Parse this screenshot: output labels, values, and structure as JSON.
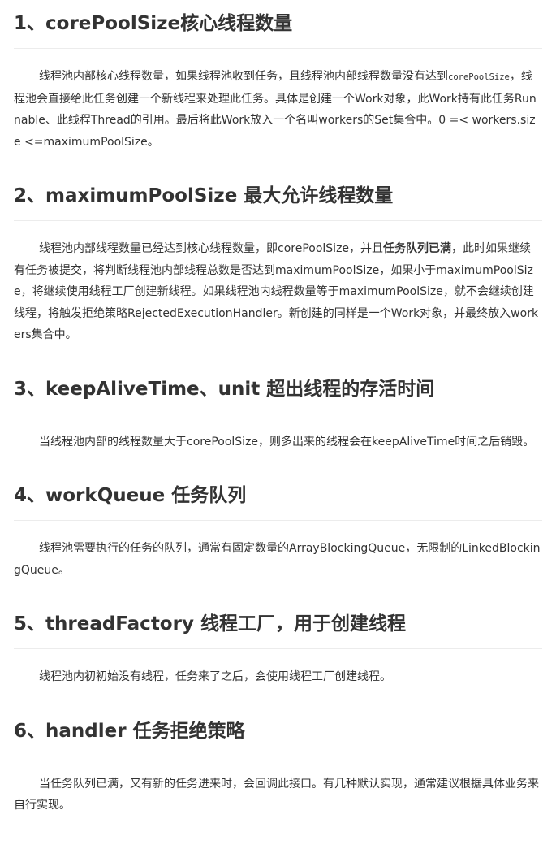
{
  "sections": [
    {
      "title": "1、corePoolSize核心线程数量",
      "para": {
        "p1": "线程池内部核心线程数量，如果线程池收到任务，且线程池内部线程数量没有达到",
        "code": "corePoolSize",
        "p2": "，线程池会直接给此任务创建一个新线程来处理此任务。具体是创建一个Work对象，此Work持有此任务Runnable、此线程Thread的引用。最后将此Work放入一个名叫workers的Set集合中。0 =< workers.size <=maximumPoolSize。"
      }
    },
    {
      "title": "2、maximumPoolSize 最大允许线程数量",
      "para": {
        "p1": "线程池内部线程数量已经达到核心线程数量，即corePoolSize，并且",
        "bold": "任务队列已满",
        "p2": "，此时如果继续有任务被提交，将判断线程池内部线程总数是否达到maximumPoolSize，如果小于maximumPoolSize，将继续使用线程工厂创建新线程。如果线程池内线程数量等于maximumPoolSize，就不会继续创建线程，将触发拒绝策略RejectedExecutionHandler。新创建的同样是一个Work对象，并最终放入workers集合中。"
      }
    },
    {
      "title": "3、keepAliveTime、unit 超出线程的存活时间",
      "para": {
        "text": "当线程池内部的线程数量大于corePoolSize，则多出来的线程会在keepAliveTime时间之后销毁。"
      }
    },
    {
      "title": "4、workQueue 任务队列",
      "para": {
        "text": "线程池需要执行的任务的队列，通常有固定数量的ArrayBlockingQueue，无限制的LinkedBlockingQueue。"
      }
    },
    {
      "title": "5、threadFactory 线程工厂，用于创建线程",
      "para": {
        "text": "线程池内初初始没有线程，任务来了之后，会使用线程工厂创建线程。"
      }
    },
    {
      "title": "6、handler 任务拒绝策略",
      "para": {
        "text": "当任务队列已满，又有新的任务进来时，会回调此接口。有几种默认实现，通常建议根据具体业务来自行实现。"
      }
    }
  ]
}
